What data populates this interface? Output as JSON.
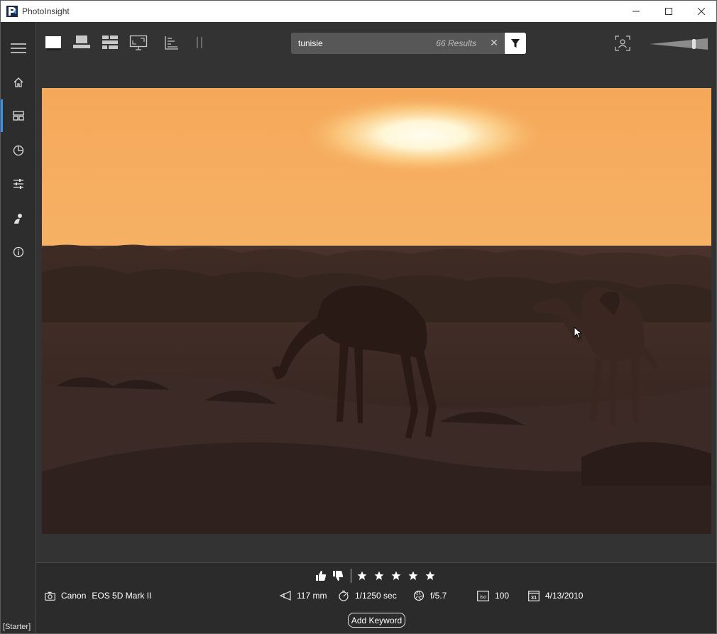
{
  "app": {
    "title": "PhotoInsight",
    "edition": "[Starter]",
    "colors": {
      "accent": "#3c91e6",
      "background": "#333333",
      "sidebar": "#2d2d2d"
    }
  },
  "window_controls": [
    "minimize-icon",
    "maximize-icon",
    "close-icon"
  ],
  "sidebar": {
    "items": [
      {
        "name": "menu",
        "icon": "hamburger-icon",
        "active": false
      },
      {
        "name": "home",
        "icon": "home-icon",
        "active": false
      },
      {
        "name": "browse",
        "icon": "grid-icon",
        "active": true
      },
      {
        "name": "statistics",
        "icon": "pie-chart-icon",
        "active": false
      },
      {
        "name": "settings",
        "icon": "sliders-icon",
        "active": false
      },
      {
        "name": "people",
        "icon": "person-icon",
        "active": false
      },
      {
        "name": "about",
        "icon": "info-icon",
        "active": false
      }
    ]
  },
  "toolbar": {
    "view_modes": [
      "single-view-icon",
      "filmstrip-view-icon",
      "grid-view-icon",
      "fullscreen-icon"
    ],
    "sort_icon": "sort-icon",
    "pause_icon": "pause-icon"
  },
  "search": {
    "value": "tunisie",
    "result_count": "66 Results",
    "clear_label": "✕"
  },
  "photo": {
    "subject": "camels-at-sunset"
  },
  "info": {
    "rating_stars": 5,
    "camera_make": "Canon",
    "camera_model": "EOS 5D Mark II",
    "focal_length": "117 mm",
    "shutter_speed": "1/1250 sec",
    "aperture": "f/5.7",
    "iso": "100",
    "date": "4/13/2010",
    "calendar_day": "31",
    "add_keyword_label": "Add Keyword"
  }
}
